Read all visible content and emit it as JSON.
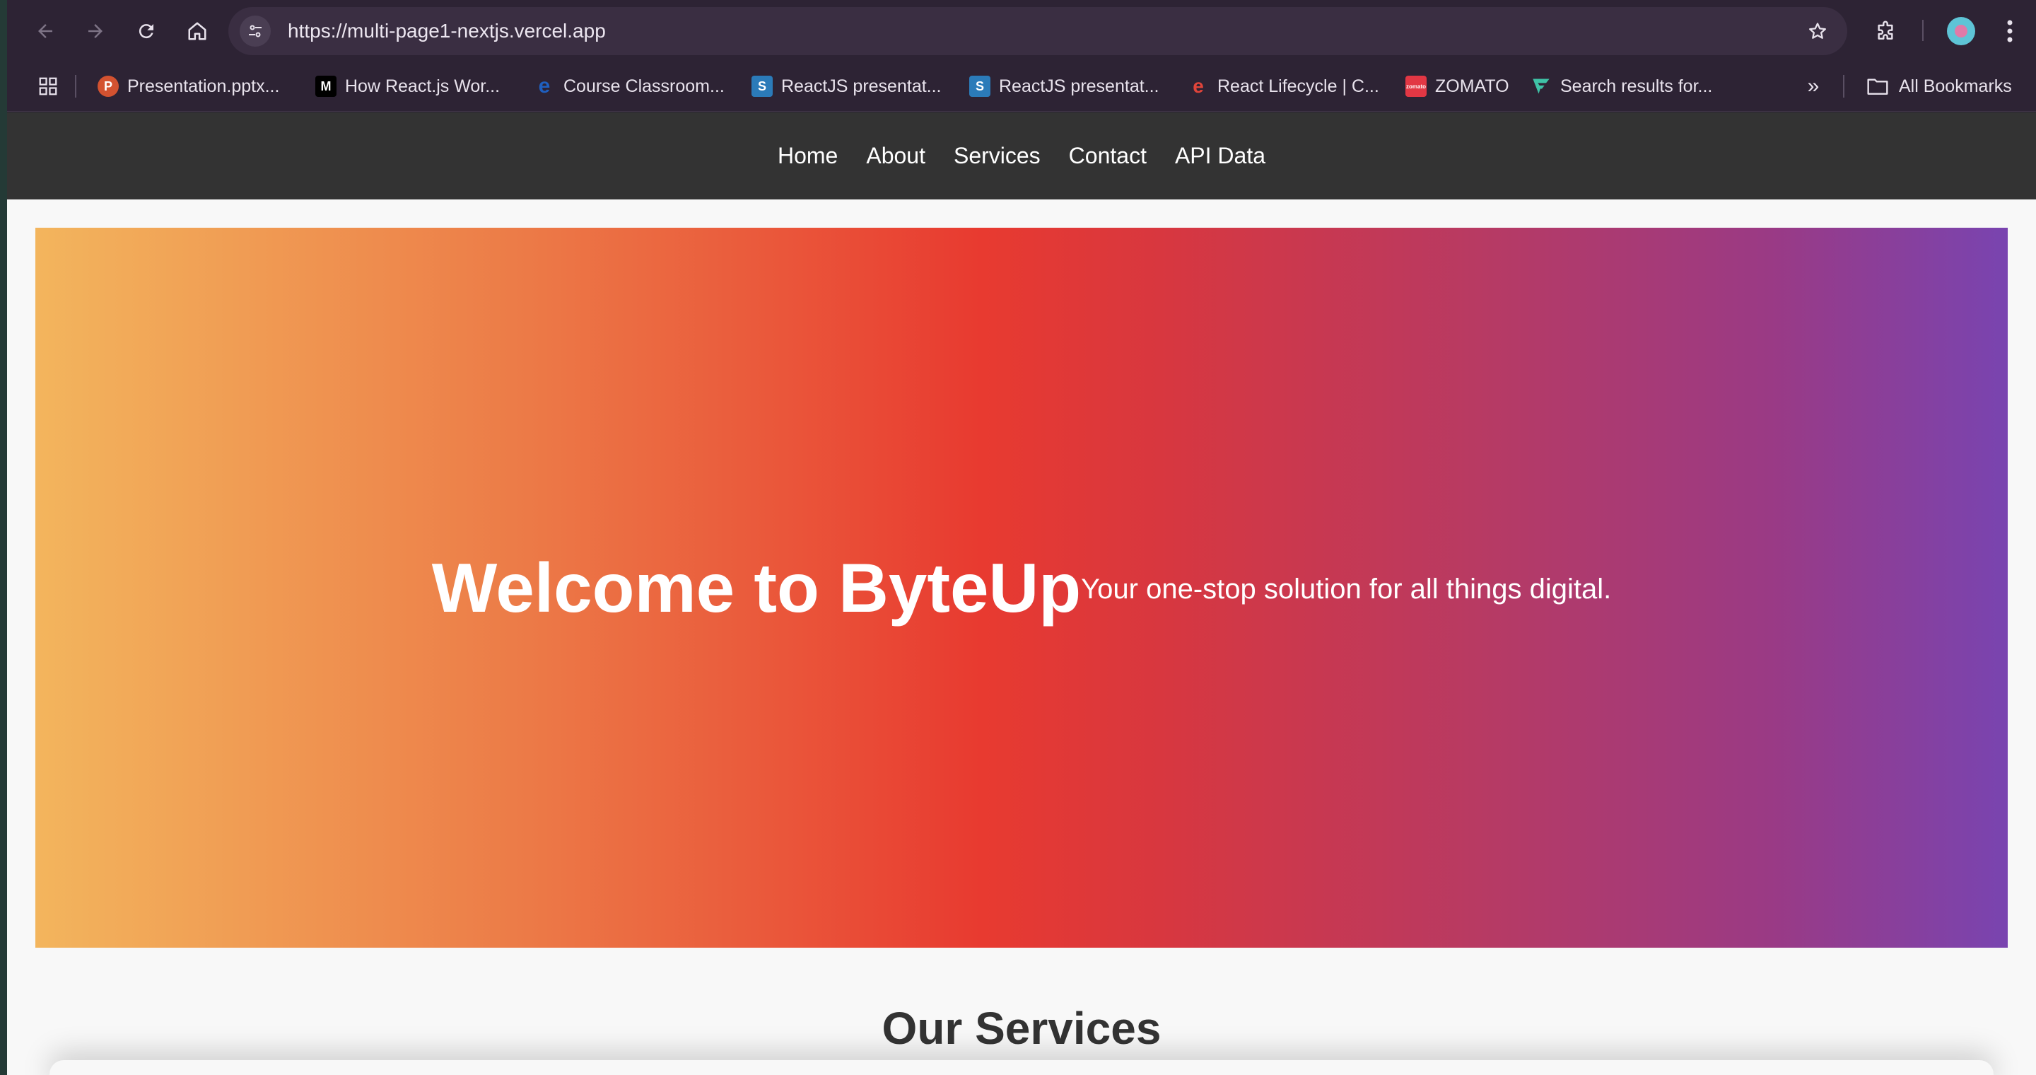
{
  "browser": {
    "url": "https://multi-page1-nextjs.vercel.app",
    "bookmarks": [
      {
        "label": "Presentation.pptx...",
        "icon": "powerpoint-icon",
        "color": "#d35230"
      },
      {
        "label": "How React.js Wor...",
        "icon": "medium-icon",
        "color": "#000000"
      },
      {
        "label": "Course Classroom...",
        "icon": "edureka-icon",
        "color": "#1f5fbf"
      },
      {
        "label": "ReactJS presentat...",
        "icon": "slideshare-icon",
        "color": "#2b7bb9"
      },
      {
        "label": "ReactJS presentat...",
        "icon": "slideshare-icon",
        "color": "#2b7bb9"
      },
      {
        "label": "React Lifecycle | C...",
        "icon": "react-lifecycle-icon",
        "color": "#e0443a"
      },
      {
        "label": "ZOMATO",
        "icon": "zomato-icon",
        "color": "#e23744"
      },
      {
        "label": "Search results for...",
        "icon": "search-results-icon",
        "color": "#3fc2a6"
      }
    ],
    "all_bookmarks_label": "All Bookmarks"
  },
  "site": {
    "nav": [
      "Home",
      "About",
      "Services",
      "Contact",
      "API Data"
    ],
    "hero_title": "Welcome to ByteUp",
    "hero_subtitle": "Your one-stop solution for all things digital.",
    "services_title": "Our Services"
  }
}
